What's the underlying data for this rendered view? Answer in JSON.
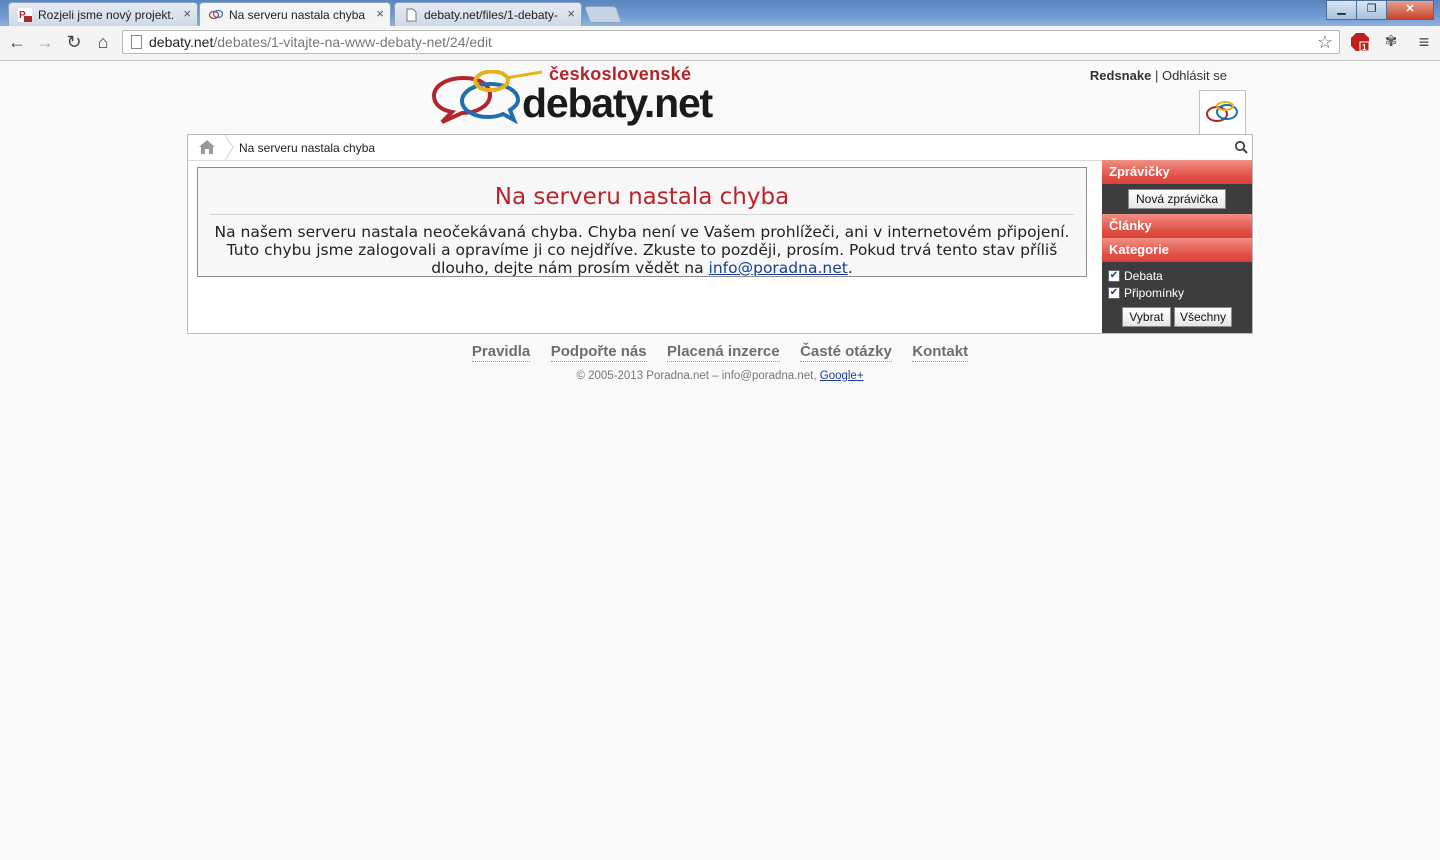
{
  "browser": {
    "tabs": [
      {
        "title": "Rozjeli jsme nový projekt...",
        "active": false
      },
      {
        "title": "Na serveru nastala chyba",
        "active": true
      },
      {
        "title": "debaty.net/files/1-debaty-",
        "active": false
      }
    ],
    "tab_close": "×",
    "window_buttons": {
      "minimize": "▁",
      "maximize": "❐",
      "close": "✕"
    },
    "url_host": "debaty.net",
    "url_path": "/debates/1-vitajte-na-www-debaty-net/24/edit"
  },
  "header": {
    "logo_line1": "československé",
    "logo_line2": "debaty.net",
    "username": "Redsnake",
    "separator": "|",
    "logout": "Odhlásit se"
  },
  "breadcrumb": {
    "current": "Na serveru nastala chyba"
  },
  "error": {
    "title": "Na serveru nastala chyba",
    "message": "Na našem serveru nastala neočekávaná chyba. Chyba není ve Vašem prohlížeči, ani v internetovém připojení. Tuto chybu jsme zalogovali a opravíme ji co nejdříve. Zkuste to později, prosím. Pokud trvá tento stav příliš dlouho, dejte nám prosím vědět na",
    "email": "info@poradna.net",
    "end": "."
  },
  "sidebar": {
    "news_header": "Zprávičky",
    "new_news_button": "Nová zprávička",
    "articles_header": "Články",
    "categories_header": "Kategorie",
    "categories": [
      {
        "label": "Debata",
        "checked": true
      },
      {
        "label": "Připomínky",
        "checked": true
      }
    ],
    "select_button": "Vybrat",
    "all_button": "Všechny"
  },
  "footer": {
    "links": [
      "Pravidla",
      "Podpořte nás",
      "Placená inzerce",
      "Časté otázky",
      "Kontakt"
    ],
    "copyright": "© 2005-2013 Poradna.net – info@poradna.net,",
    "google": "Google+"
  },
  "colors": {
    "accent_red": "#b8262a",
    "sidebar_header": "#e04e46",
    "sidebar_bg": "#3d3d3d",
    "link_blue": "#1a3f91"
  }
}
